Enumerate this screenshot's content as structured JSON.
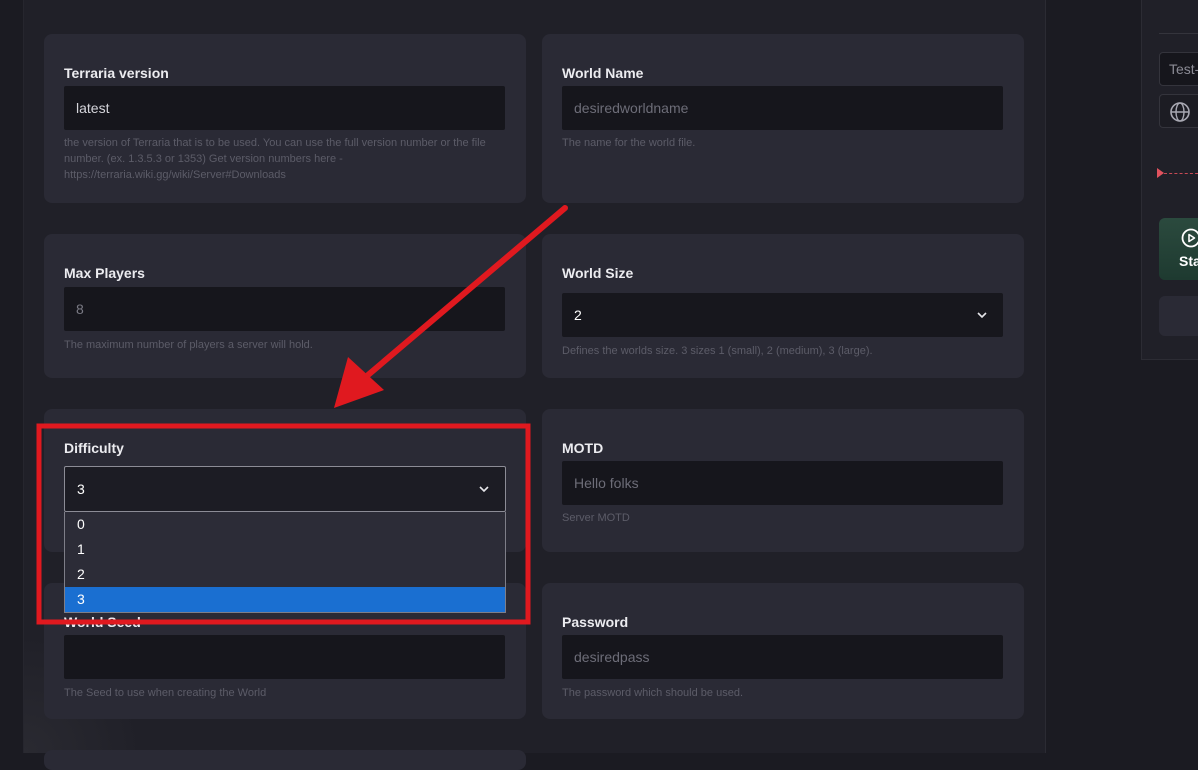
{
  "fields": {
    "terraria_version": {
      "label": "Terraria version",
      "value": "latest",
      "description": "the version of Terraria that is to be used. You can use the full version number or the file number. (ex. 1.3.5.3 or 1353) Get version numbers here - https://terraria.wiki.gg/wiki/Server#Downloads"
    },
    "world_name": {
      "label": "World Name",
      "placeholder": "desiredworldname",
      "description": "The name for the world file."
    },
    "max_players": {
      "label": "Max Players",
      "value": "8",
      "description": "The maximum number of players a server will hold."
    },
    "world_size": {
      "label": "World Size",
      "value": "2",
      "description": "Defines the worlds size. 3 sizes 1 (small), 2 (medium), 3 (large)."
    },
    "difficulty": {
      "label": "Difficulty",
      "value": "3",
      "options": [
        "0",
        "1",
        "2",
        "3"
      ],
      "selected_index": 3
    },
    "motd": {
      "label": "MOTD",
      "placeholder": "Hello folks",
      "description": "Server MOTD"
    },
    "world_seed": {
      "label": "World Seed",
      "value": "",
      "description": "The Seed to use when creating the World"
    },
    "password": {
      "label": "Password",
      "placeholder": "desiredpass",
      "description": "The password which should be used."
    }
  },
  "right_panel": {
    "server_name_input": "Test-",
    "start_button_label": "Sta"
  },
  "colors": {
    "annotation_red": "#e0191f",
    "selected_option": "#1a6fd1",
    "card_bg": "#2a2a35",
    "input_bg": "#16161c"
  },
  "icons": [
    "chevron-down-icon",
    "globe-icon",
    "play-icon"
  ]
}
